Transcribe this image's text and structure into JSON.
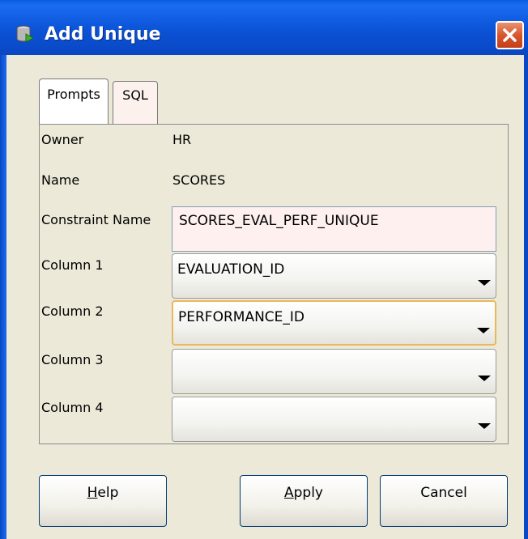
{
  "window": {
    "title": "Add Unique",
    "icon": "database-icon",
    "close_icon": "close-icon"
  },
  "tabs": [
    {
      "label": "Prompts",
      "selected": true
    },
    {
      "label": "SQL",
      "selected": false
    }
  ],
  "form": {
    "owner_label": "Owner",
    "owner_value": "HR",
    "name_label": "Name",
    "name_value": "SCORES",
    "constraint_name_label": "Constraint Name",
    "constraint_name_value": "SCORES_EVAL_PERF_UNIQUE",
    "columns": [
      {
        "label": "Column 1",
        "value": "EVALUATION_ID"
      },
      {
        "label": "Column 2",
        "value": "PERFORMANCE_ID"
      },
      {
        "label": "Column 3",
        "value": ""
      },
      {
        "label": "Column 4",
        "value": ""
      }
    ]
  },
  "buttons": {
    "help": {
      "mnemonic": "H",
      "rest": "elp"
    },
    "apply": {
      "mnemonic": "A",
      "rest": "pply"
    },
    "cancel": "Cancel"
  },
  "colors": {
    "titlebar": "#0b52d6",
    "close_button": "#d9552c",
    "focus_border": "#e8b95a",
    "field_bg": "#fdf0ee"
  }
}
